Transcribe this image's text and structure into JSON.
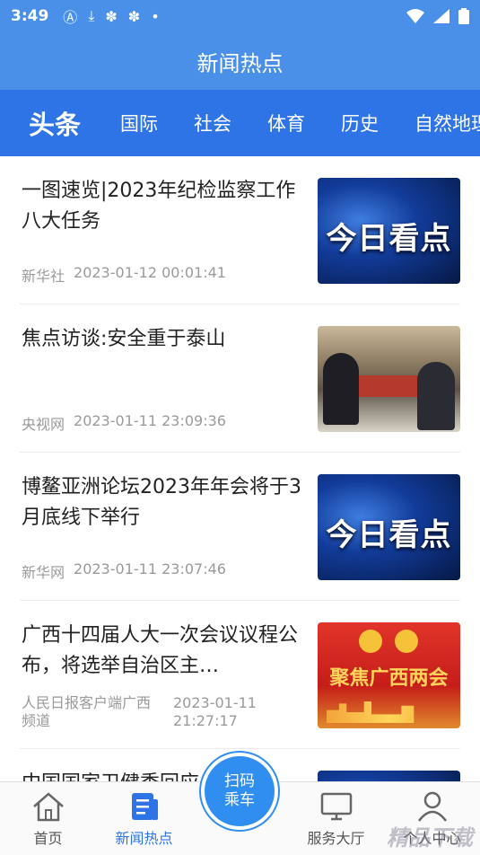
{
  "status_bar": {
    "time": "3:49",
    "icons": [
      "a-icon",
      "download-icon",
      "app-icon",
      "app-icon",
      "dot-icon"
    ],
    "right_icons": [
      "wifi-icon",
      "signal-icon",
      "battery-icon"
    ]
  },
  "header": {
    "title": "新闻热点"
  },
  "tabs": [
    {
      "label": "头条",
      "active": true
    },
    {
      "label": "国际"
    },
    {
      "label": "社会"
    },
    {
      "label": "体育"
    },
    {
      "label": "历史"
    },
    {
      "label": "自然地理"
    }
  ],
  "news": [
    {
      "title": "一图速览|2023年纪检监察工作八大任务",
      "source": "新华社",
      "datetime": "2023-01-12 00:01:41",
      "thumb_text": "今日看点"
    },
    {
      "title": "焦点访谈:安全重于泰山",
      "source": "央视网",
      "datetime": "2023-01-11 23:09:36"
    },
    {
      "title": "博鳌亚洲论坛2023年年会将于3月底线下举行",
      "source": "新华网",
      "datetime": "2023-01-11 23:07:46",
      "thumb_text": "今日看点"
    },
    {
      "title": "广西十四届人大一次会议议程公布，将选举自治区主…",
      "source": "人民日报客户端广西频道",
      "datetime": "2023-01-11 21:27:17",
      "thumb_text": "聚焦广西两会"
    },
    {
      "title": "中国国家卫健委回应…",
      "source": "",
      "datetime": ""
    }
  ],
  "bottom_nav": [
    {
      "label": "首页",
      "icon": "home-icon"
    },
    {
      "label": "新闻热点",
      "icon": "news-icon",
      "active": true
    },
    {
      "label": "服务大厅",
      "icon": "service-icon"
    },
    {
      "label": "个人中心",
      "icon": "user-icon"
    }
  ],
  "scan_button": {
    "line1": "扫码",
    "line2": "乘车"
  },
  "watermark": "精品下载"
}
